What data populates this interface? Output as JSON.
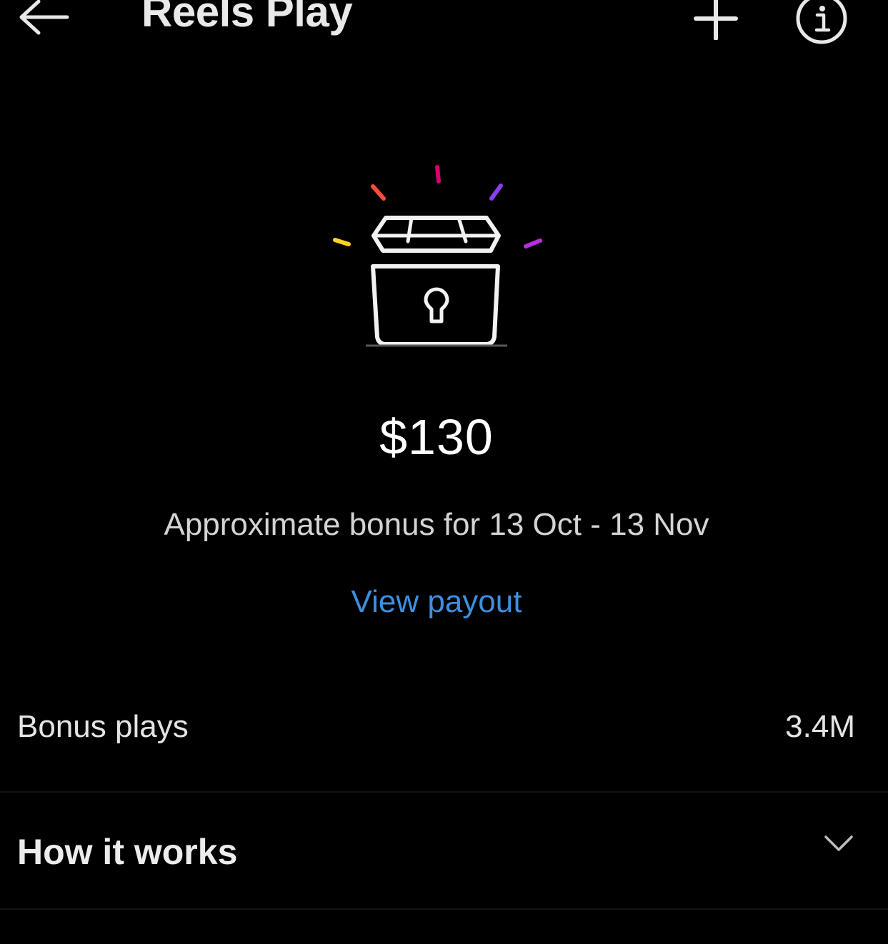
{
  "header": {
    "title": "Reels Play",
    "back_icon": "arrow-left-icon",
    "add_icon": "plus-icon",
    "info_icon": "info-circle-icon"
  },
  "hero": {
    "icon": "treasure-chest-lock-icon",
    "ray_colors": [
      "#d6006f",
      "#ff4b3a",
      "#8b3ff0",
      "#ffd21f",
      "#b62fe0"
    ]
  },
  "bonus": {
    "amount": "$130",
    "period_text": "Approximate bonus for 13 Oct - 13 Nov",
    "view_payout_label": "View payout"
  },
  "stats": {
    "label": "Bonus plays",
    "value": "3.4M"
  },
  "accordion": {
    "title": "How it works",
    "icon": "chevron-down-icon"
  },
  "colors": {
    "background": "#000000",
    "link": "#3d8fe0",
    "text": "#f2f2f2"
  }
}
